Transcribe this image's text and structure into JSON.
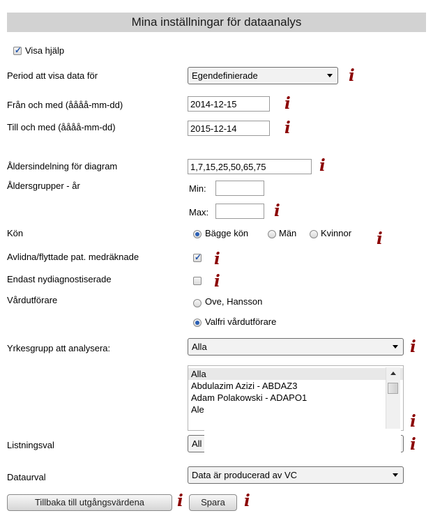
{
  "header": {
    "title": "Mina inställningar för dataanalys"
  },
  "help": {
    "label": "Visa hjälp",
    "checked": true
  },
  "period": {
    "label": "Period att visa data för",
    "value": "Egendefinierade"
  },
  "from_date": {
    "label": "Från och med (åååå-mm-dd)",
    "value": "2014-12-15"
  },
  "to_date": {
    "label": "Till och med (åååå-mm-dd)",
    "value": "2015-12-14"
  },
  "age_division": {
    "label": "Åldersindelning för diagram",
    "value": "1,7,15,25,50,65,75"
  },
  "age_groups": {
    "label": "Åldersgrupper - år",
    "min_label": "Min:",
    "max_label": "Max:",
    "min_value": "",
    "max_value": ""
  },
  "gender": {
    "label": "Kön",
    "options": [
      "Bägge kön",
      "Män",
      "Kvinnor"
    ],
    "selected": "Bägge kön"
  },
  "deceased": {
    "label": "Avlidna/flyttade pat. medräknade",
    "checked": true
  },
  "new_diagnosed": {
    "label": "Endast nydiagnostiserade",
    "checked": false
  },
  "care_provider": {
    "label": "Vårdutförare",
    "options": [
      "Ove, Hansson",
      "Valfri vårdutförare"
    ],
    "selected": "Valfri vårdutförare"
  },
  "profession": {
    "label": "Yrkesgrupp att analysera:",
    "value": "Alla"
  },
  "profession_list": {
    "items": [
      "Alla",
      "Abdulazim Azizi - ABDAZ3",
      "Adam Polakowski - ADAPO1",
      "Ale"
    ]
  },
  "listing": {
    "label": "Listningsval",
    "value": "All"
  },
  "data_selection": {
    "label": "Dataurval",
    "value": "Data är producerad av VC"
  },
  "buttons": {
    "reset": "Tillbaka till utgångsvärdena",
    "save": "Spara"
  },
  "info_glyph": "i",
  "colors": {
    "header_bg": "#d2d2d2",
    "info": "#8b0000",
    "accent": "#2a5fb5"
  }
}
